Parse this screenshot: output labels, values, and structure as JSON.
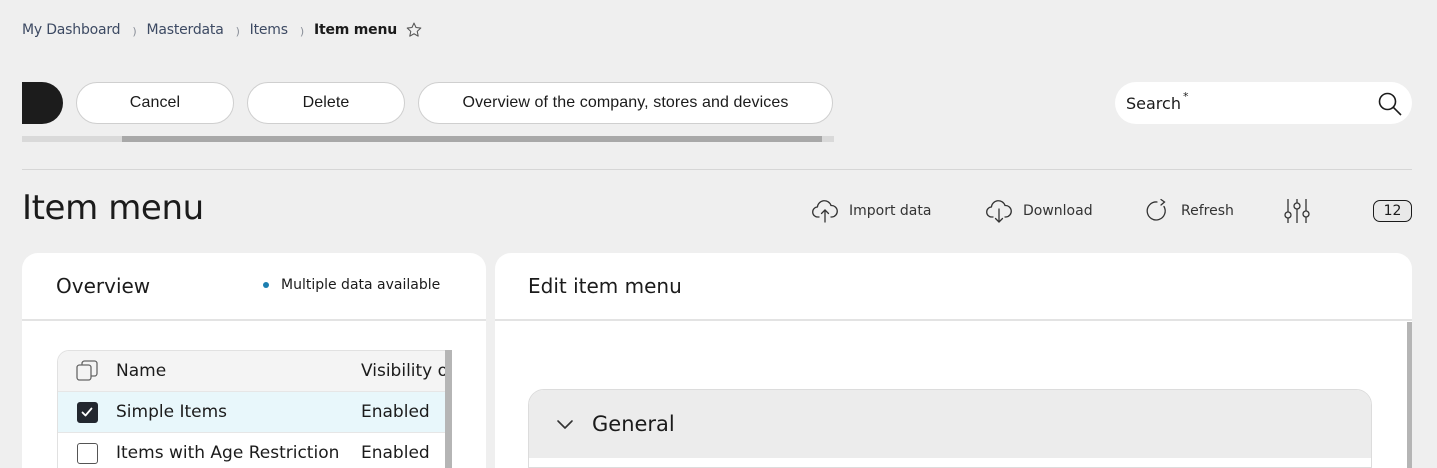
{
  "breadcrumb": {
    "items": [
      "My Dashboard",
      "Masterdata",
      "Items"
    ],
    "current": "Item menu"
  },
  "toolbar": {
    "cancel_label": "Cancel",
    "delete_label": "Delete",
    "overview_label": "Overview of the company, stores and devices"
  },
  "search": {
    "label": "Search",
    "required_mark": "*"
  },
  "page": {
    "title": "Item menu"
  },
  "actions": {
    "import_label": "Import data",
    "download_label": "Download",
    "refresh_label": "Refresh",
    "count": "12"
  },
  "overview": {
    "title": "Overview",
    "status": "Multiple data available",
    "status_color": "#1c7fb0",
    "columns": {
      "name": "Name",
      "visibility": "Visibility o"
    },
    "rows": [
      {
        "name": "Simple Items",
        "visibility": "Enabled",
        "checked": true
      },
      {
        "name": "Items with Age Restriction",
        "visibility": "Enabled",
        "checked": false
      }
    ]
  },
  "edit": {
    "title": "Edit item menu",
    "section_title": "General"
  }
}
